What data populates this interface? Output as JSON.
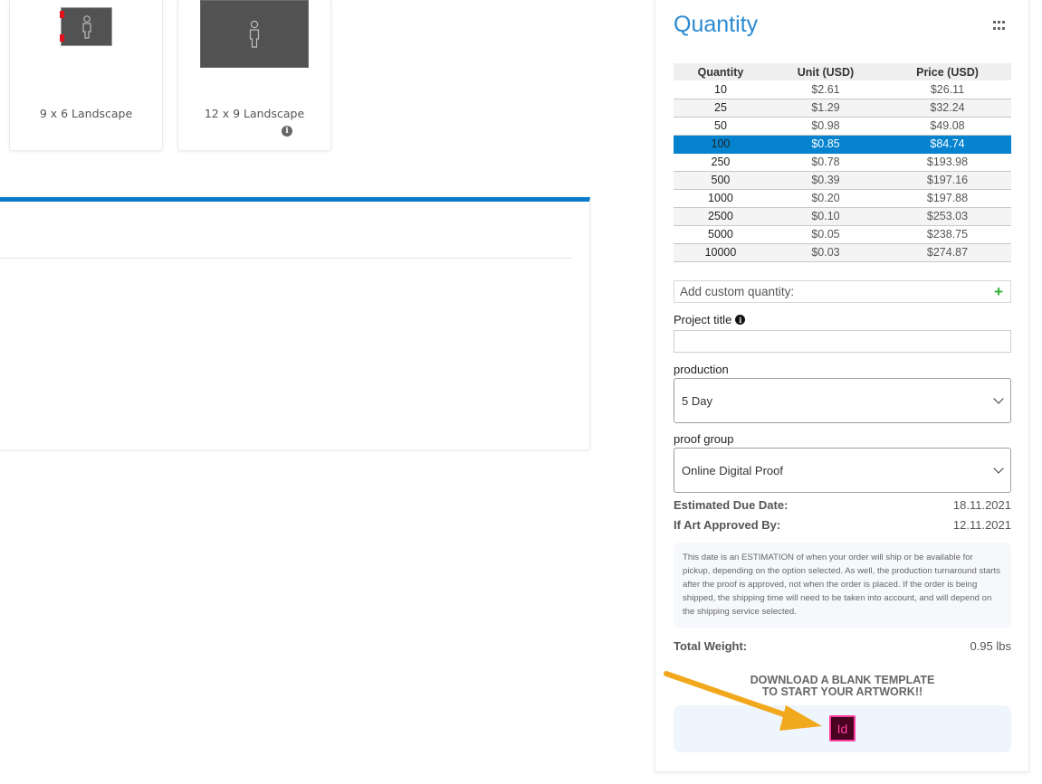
{
  "products": [
    {
      "label": "9 x 6 Landscape"
    },
    {
      "label": "12 x 9 Landscape"
    }
  ],
  "quantity": {
    "title": "Quantity",
    "headers": [
      "Quantity",
      "Unit (USD)",
      "Price (USD)"
    ],
    "rows": [
      [
        "10",
        "$2.61",
        "$26.11"
      ],
      [
        "25",
        "$1.29",
        "$32.24"
      ],
      [
        "50",
        "$0.98",
        "$49.08"
      ],
      [
        "100",
        "$0.85",
        "$84.74"
      ],
      [
        "250",
        "$0.78",
        "$193.98"
      ],
      [
        "500",
        "$0.39",
        "$197.16"
      ],
      [
        "1000",
        "$0.20",
        "$197.88"
      ],
      [
        "2500",
        "$0.10",
        "$253.03"
      ],
      [
        "5000",
        "$0.05",
        "$238.75"
      ],
      [
        "10000",
        "$0.03",
        "$274.87"
      ]
    ],
    "selected_quantity": "100",
    "custom_placeholder": "Add custom quantity:"
  },
  "form": {
    "project_title_label": "Project title",
    "project_title_value": "",
    "production_label": "production",
    "production_value": "5 Day",
    "proof_group_label": "proof group",
    "proof_group_value": "Online Digital Proof"
  },
  "estimate": {
    "due_date_label": "Estimated Due Date:",
    "due_date_value": "18.11.2021",
    "approved_by_label": "If Art Approved By:",
    "approved_by_value": "12.11.2021",
    "note": "This date is an ESTIMATION of when your order will ship or be available for pickup, depending on the option selected. As well, the production turnaround starts after the proof is approved, not when the order is placed. If the order is being shipped, the shipping time will need to be taken into account, and will depend on the shipping service selected.",
    "total_weight_label": "Total Weight:",
    "total_weight_value": "0.95 lbs"
  },
  "template": {
    "line1": "DOWNLOAD A BLANK TEMPLATE",
    "line2": "TO START YOUR ARTWORK!!",
    "indesign_label": "Id"
  },
  "colors": {
    "accent": "#2b8ad1",
    "selected_row": "#0583cf",
    "arrow": "#f2a81d",
    "indesign": "#ff3ca0"
  }
}
